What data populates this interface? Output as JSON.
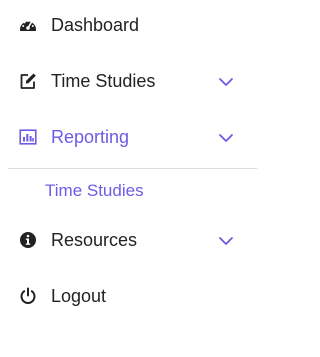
{
  "colors": {
    "accent": "#6b5ce7",
    "text": "#222222",
    "divider": "#dddddd"
  },
  "menu": {
    "items": [
      {
        "label": "Dashboard",
        "icon": "dashboard-gauge-icon",
        "expandable": false
      },
      {
        "label": "Time Studies",
        "icon": "edit-icon",
        "expandable": true
      },
      {
        "label": "Reporting",
        "icon": "bar-chart-icon",
        "expandable": true,
        "active": true
      },
      {
        "label": "Resources",
        "icon": "info-circle-icon",
        "expandable": true
      },
      {
        "label": "Logout",
        "icon": "power-icon",
        "expandable": false
      }
    ],
    "reporting_submenu": [
      {
        "label": "Time Studies"
      }
    ]
  }
}
